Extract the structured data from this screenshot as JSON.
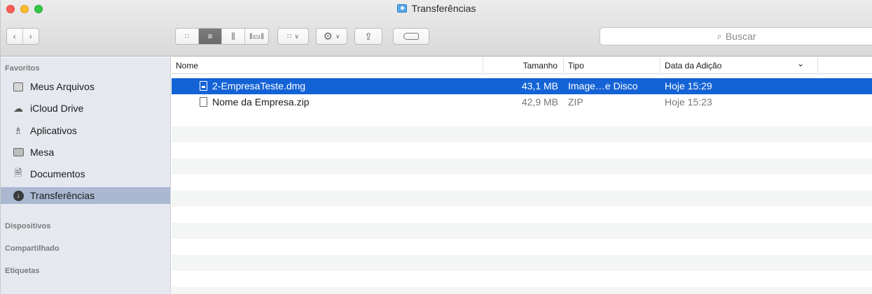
{
  "window": {
    "title": "Transferências"
  },
  "toolbar": {
    "back_icon": "chevron-left",
    "forward_icon": "chevron-right",
    "view_modes": [
      "icons",
      "list",
      "columns",
      "cover-flow"
    ],
    "arrange_icon": "grid-dropdown",
    "action_icon": "gear-dropdown",
    "share_icon": "share",
    "tag_icon": "tag"
  },
  "search": {
    "placeholder": "Buscar"
  },
  "sidebar": {
    "favorites_label": "Favoritos",
    "items": [
      {
        "label": "Meus Arquivos",
        "icon": "all-files-icon"
      },
      {
        "label": "iCloud Drive",
        "icon": "cloud-icon"
      },
      {
        "label": "Aplicativos",
        "icon": "applications-icon"
      },
      {
        "label": "Mesa",
        "icon": "desktop-icon"
      },
      {
        "label": "Documentos",
        "icon": "documents-icon"
      },
      {
        "label": "Transferências",
        "icon": "downloads-icon"
      }
    ],
    "devices_label": "Dispositivos",
    "shared_label": "Compartilhado",
    "tags_label": "Etiquetas"
  },
  "columns": {
    "name": "Nome",
    "size": "Tamanho",
    "kind": "Tipo",
    "date_added": "Data da Adição",
    "sort_arrow": "⌄"
  },
  "files": [
    {
      "name": "2-EmpresaTeste.dmg",
      "size": "43,1 MB",
      "kind": "Image…e Disco",
      "date_added": "Hoje 15:29"
    },
    {
      "name": "Nome da Empresa.zip",
      "size": "42,9 MB",
      "kind": "ZIP",
      "date_added": "Hoje 15:23"
    }
  ],
  "colors": {
    "selection": "#1463d6",
    "sidebar_selected": "#aab9d1",
    "sidebar_bg": "#e5e9ef"
  }
}
